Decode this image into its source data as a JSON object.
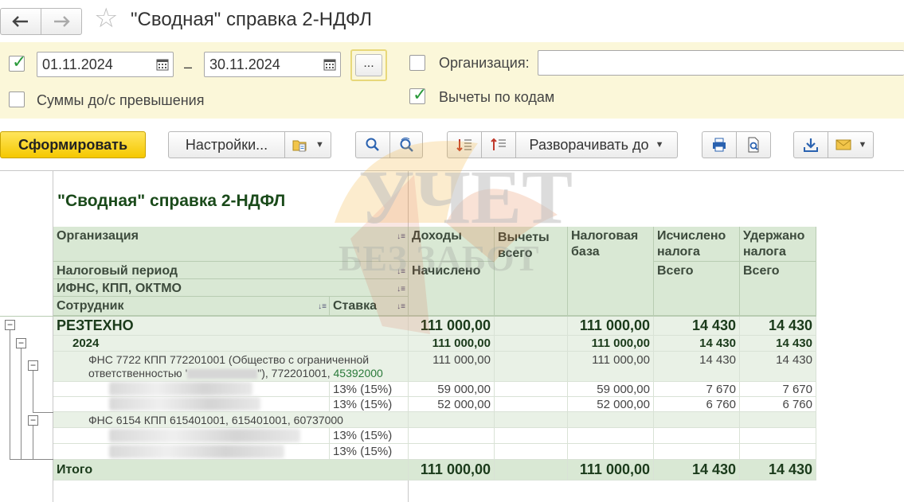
{
  "window": {
    "title": "\"Сводная\" справка 2-НДФЛ"
  },
  "nav": {
    "back": "🡐",
    "forward": "🡒"
  },
  "filters": {
    "period_checked": true,
    "date_from": "01.11.2024",
    "date_to": "30.11.2024",
    "dash": "–",
    "dots_label": "...",
    "organization_label": "Организация:",
    "organization_value": "",
    "sums_label": "Суммы до/с превышения",
    "deductions_label": "Вычеты по кодам",
    "deductions_checked": true
  },
  "toolbar": {
    "generate": "Сформировать",
    "settings": "Настройки...",
    "expand_to": "Разворачивать до"
  },
  "report": {
    "title": "\"Сводная\" справка 2-НДФЛ",
    "headers": {
      "organization": "Организация",
      "period": "Налоговый период",
      "ifns": "ИФНС, КПП, ОКТМО",
      "employee": "Сотрудник",
      "rate": "Ставка",
      "income": "Доходы",
      "accrued": "Начислено",
      "deductions": "Вычеты всего",
      "tax_base": "Налоговая база",
      "calculated": "Исчислено налога",
      "calculated_total": "Всего",
      "withheld": "Удержано налога",
      "withheld_total": "Всего"
    },
    "rows": [
      {
        "label": "РЕЗТЕХНО",
        "rate": "",
        "income": "111 000,00",
        "deductions": "",
        "base": "111 000,00",
        "calc": "14 430",
        "withheld": "14 430"
      },
      {
        "label": "2024",
        "rate": "",
        "income": "111 000,00",
        "deductions": "",
        "base": "111 000,00",
        "calc": "14 430",
        "withheld": "14 430"
      },
      {
        "label": "ФНС 7722 КПП 772201001 (Общество с ограниченной",
        "label2a": "ответственностью '",
        "label2b": "\"), 772201001, ",
        "label2c": "45392000",
        "rate": "",
        "income": "111 000,00",
        "deductions": "",
        "base": "111 000,00",
        "calc": "14 430",
        "withheld": "14 430"
      },
      {
        "label": "",
        "rate": "13% (15%)",
        "income": "59 000,00",
        "deductions": "",
        "base": "59 000,00",
        "calc": "7 670",
        "withheld": "7 670"
      },
      {
        "label": "",
        "rate": "13% (15%)",
        "income": "52 000,00",
        "deductions": "",
        "base": "52 000,00",
        "calc": "6 760",
        "withheld": "6 760"
      },
      {
        "label": "ФНС 6154 КПП 615401001, 615401001, 60737000",
        "rate": "",
        "income": "",
        "deductions": "",
        "base": "",
        "calc": "",
        "withheld": ""
      },
      {
        "label": "",
        "rate": "13% (15%)",
        "income": "",
        "deductions": "",
        "base": "",
        "calc": "",
        "withheld": ""
      },
      {
        "label": "",
        "rate": "13% (15%)",
        "income": "",
        "deductions": "",
        "base": "",
        "calc": "",
        "withheld": ""
      }
    ],
    "total": {
      "label": "Итого",
      "income": "111 000,00",
      "deductions": "",
      "base": "111 000,00",
      "calc": "14 430",
      "withheld": "14 430"
    }
  },
  "watermark": {
    "line1": "УЧЕТ",
    "line2": "БЕЗ ЗАБОТ"
  },
  "colors": {
    "accent_yellow": "#f5c800",
    "header_green": "#d9e8d4",
    "row_green": "#e9f1e6",
    "filter_bg": "#fbf7d9",
    "check_green": "#2a9a3a"
  }
}
